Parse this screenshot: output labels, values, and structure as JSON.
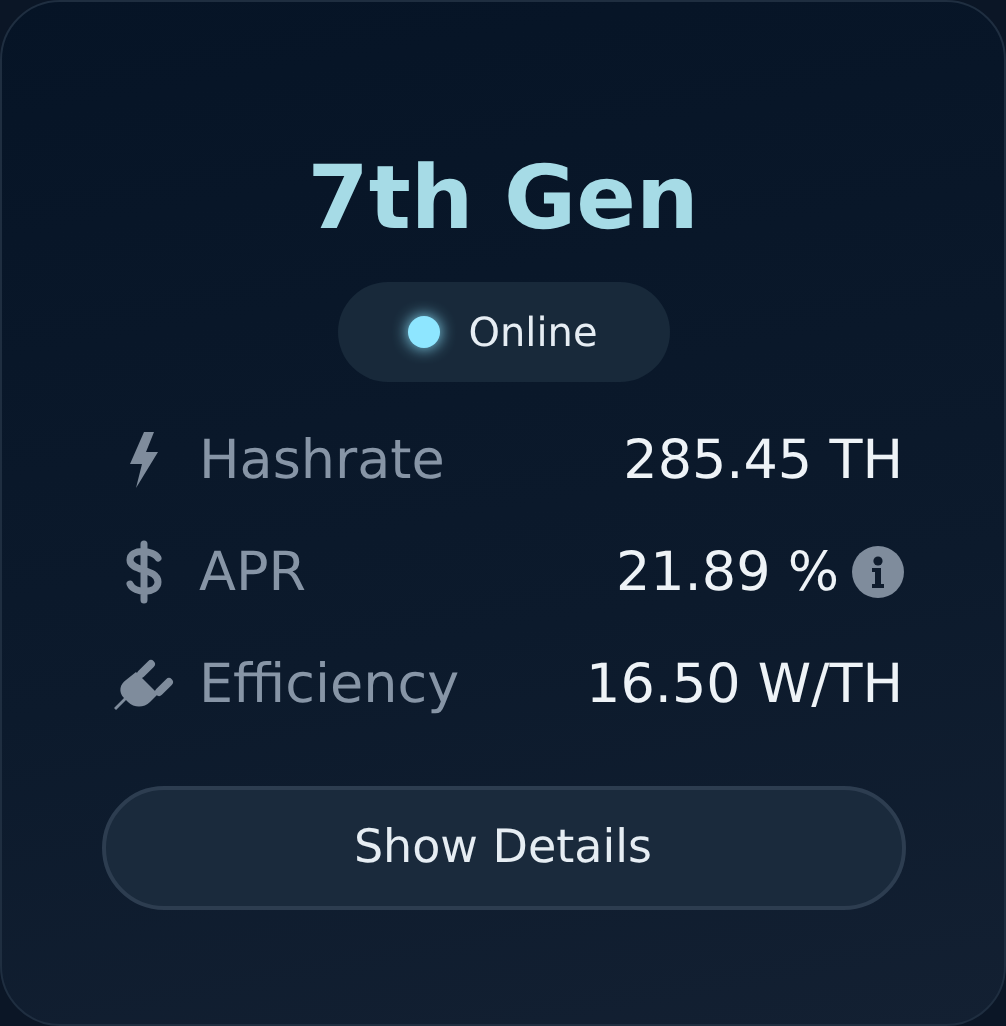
{
  "title": "7th Gen",
  "status": {
    "label": "Online",
    "online": true
  },
  "metrics": [
    {
      "kind": "bolt",
      "label": "Hashrate",
      "value": "285.45 TH",
      "info": false
    },
    {
      "kind": "dollar",
      "label": "APR",
      "value": "21.89 %",
      "info": true
    },
    {
      "kind": "plug",
      "label": "Efficiency",
      "value": "16.50 W/TH",
      "info": false
    }
  ],
  "button": "Show Details"
}
